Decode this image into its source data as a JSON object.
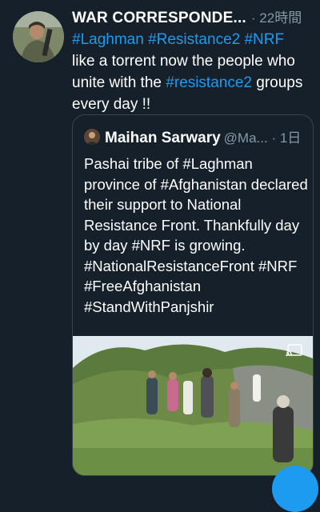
{
  "tweet": {
    "author_name": "WAR CORRESPONDE...",
    "time_meta": "· 22時間",
    "hashtags_line": [
      "#Laghman",
      "#Resistance2",
      "#NRF"
    ],
    "text_part1": "like a torrent now the people who unite with the ",
    "text_hashtag": "#resistance2",
    "text_part2": " groups every day !!"
  },
  "quote": {
    "author_name": "Maihan Sarwary",
    "handle_meta": "@Ma... · 1日",
    "text": "Pashai tribe of #Laghman province of #Afghanistan declared their support to National Resistance Front. Thankfully day by day #NRF is growing.\n#NationalResistanceFront #NRF\n#FreeAfghanistan\n#StandWithPanjshir",
    "media": {
      "type": "video",
      "icon": "cast-icon"
    }
  },
  "colors": {
    "background": "#15202b",
    "accent": "#1d9bf0",
    "muted": "#8899a6",
    "border": "#38444d"
  }
}
